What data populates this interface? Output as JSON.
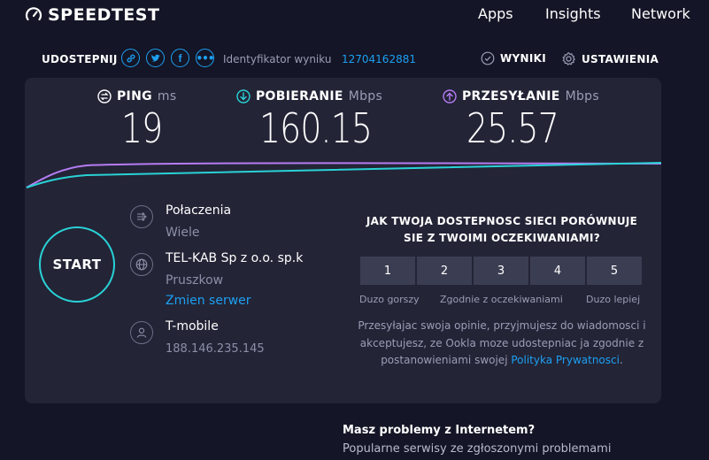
{
  "header": {
    "logo_text": "SPEEDTEST",
    "nav": [
      "Apps",
      "Insights",
      "Network"
    ]
  },
  "share": {
    "label": "UDOSTEPNIJ",
    "icons": [
      "link-icon",
      "twitter-icon",
      "facebook-icon",
      "more-icon"
    ],
    "result_id_label": "Identyfikator wyniku",
    "result_id_value": "12704162881",
    "results_label": "WYNIKI",
    "settings_label": "USTAWIENIA"
  },
  "metrics": {
    "ping": {
      "label": "PING",
      "unit": "ms",
      "value": "19"
    },
    "download": {
      "label": "POBIERANIE",
      "unit": "Mbps",
      "value": "160.15"
    },
    "upload": {
      "label": "PRZESYŁANIE",
      "unit": "Mbps",
      "value": "25.57"
    }
  },
  "colors": {
    "accent": "#1da0f2",
    "download": "#29d2d6",
    "upload": "#b57cf2",
    "background": "#141526",
    "panel": "#232436"
  },
  "start_label": "START",
  "connection": {
    "type_label": "Połaczenia",
    "type_value": "Wiele",
    "provider": "TEL-KAB Sp z o.o. sp.k",
    "location": "Pruszkow",
    "change_server": "Zmien serwer",
    "host": "T-mobile",
    "ip": "188.146.235.145"
  },
  "rating": {
    "question_line1": "JAK TWOJA DOSTEPNOSC SIECI PORÓWNUJE",
    "question_line2": "SIE Z TWOIMI OCZEKIWANIAMI?",
    "scale": [
      "1",
      "2",
      "3",
      "4",
      "5"
    ],
    "low_label": "Duzo gorszy",
    "mid_label": "Zgodnie z oczekiwaniami",
    "high_label": "Duzo lepiej",
    "privacy_text": "Przesyłajac swoja opinie, przyjmujesz do wiadomosci i akceptujesz, ze Ookla moze udostepniac ja zgodnie z postanowieniami swojej",
    "privacy_link": "Polityka Prywatnosci",
    "privacy_end": "."
  },
  "problems": {
    "title": "Masz problemy z Internetem?",
    "subtitle": "Popularne serwisy ze zgłoszonymi problemami"
  }
}
